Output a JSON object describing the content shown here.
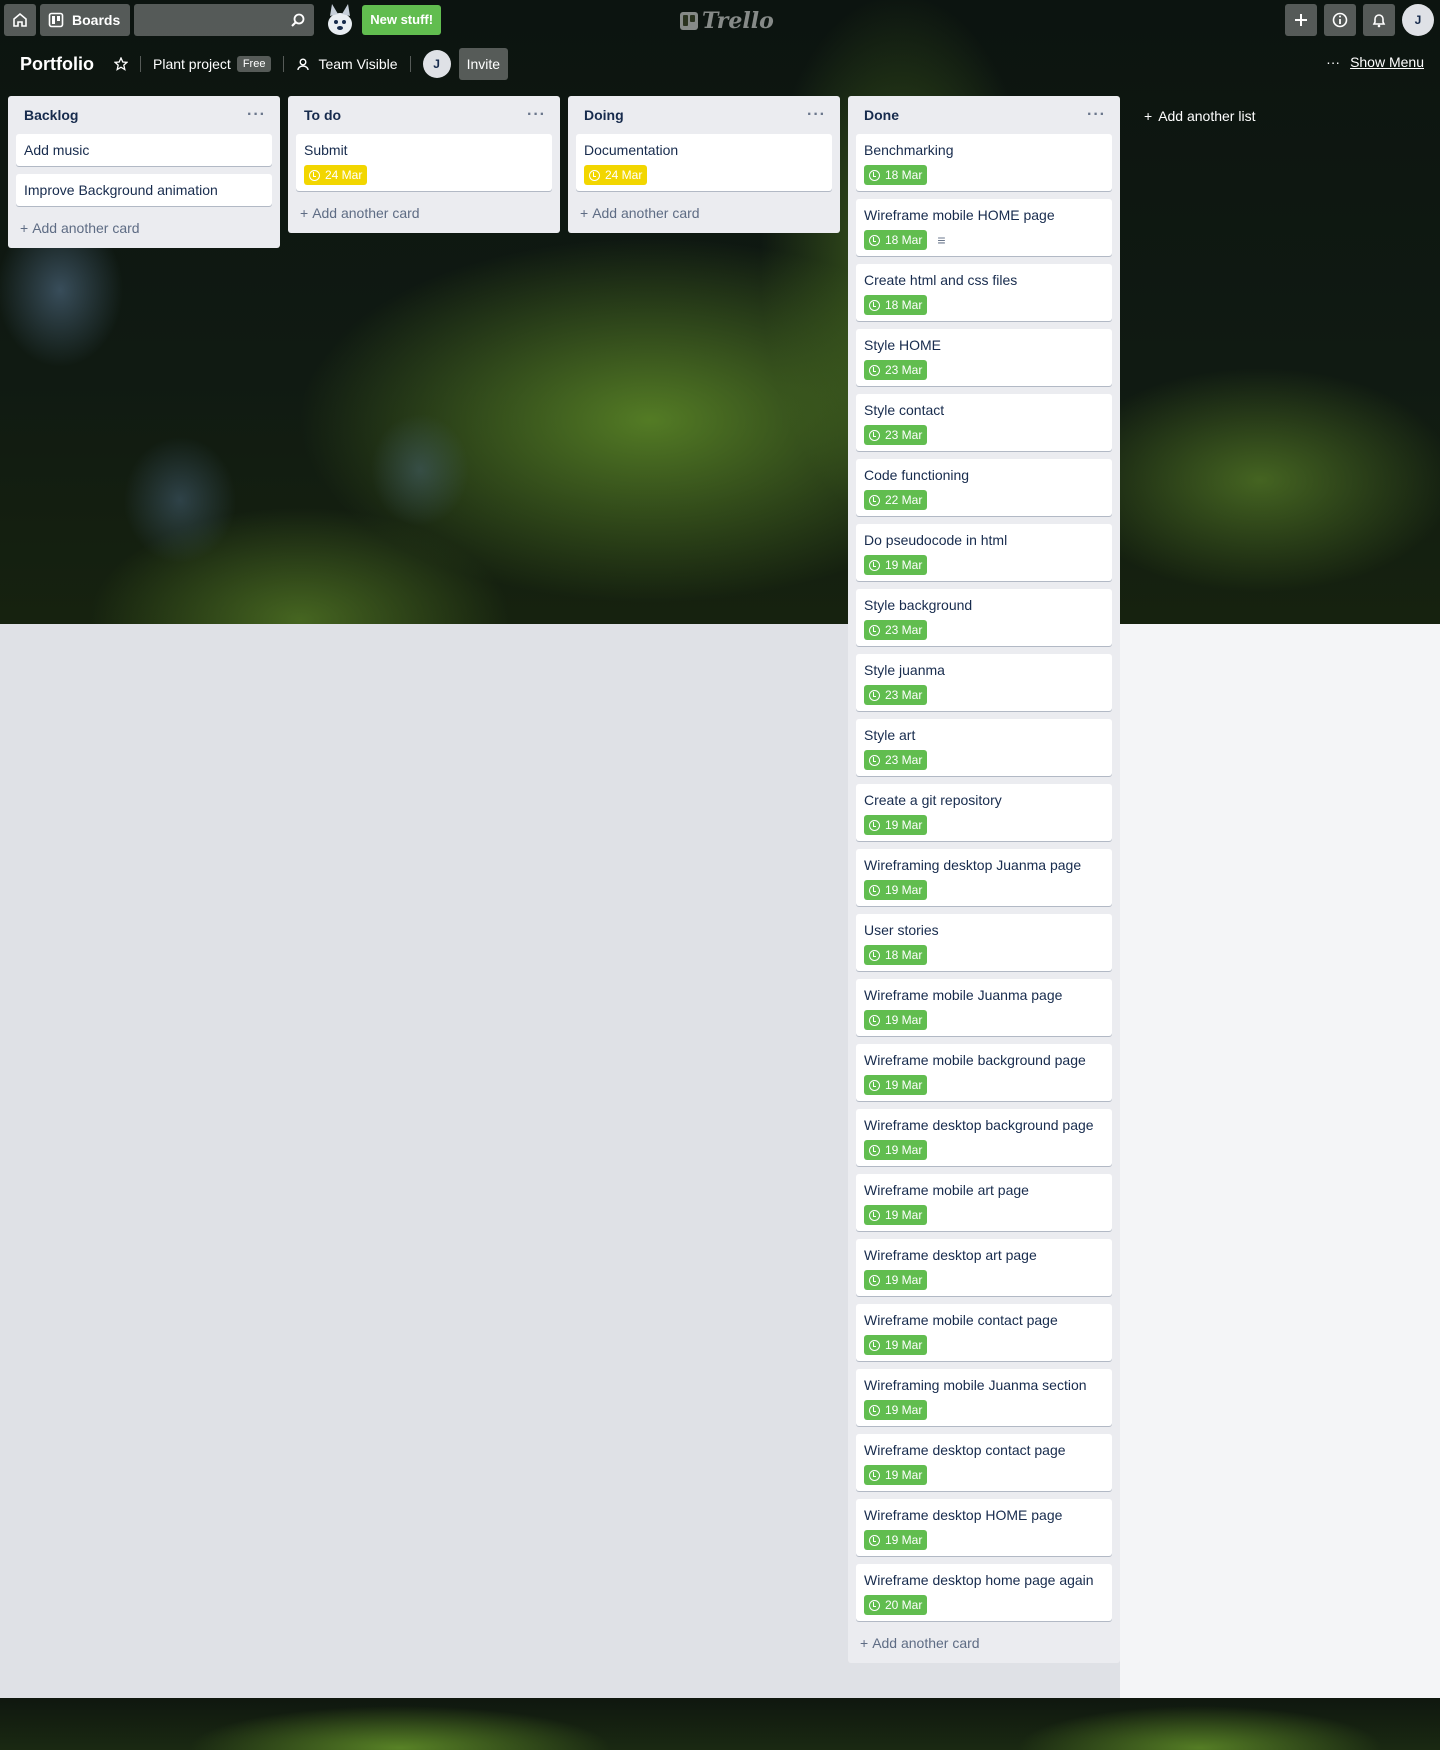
{
  "topnav": {
    "boards_label": "Boards",
    "new_stuff_label": "New stuff!",
    "logo_text": "Trello",
    "user_initial": "J"
  },
  "board": {
    "title": "Portfolio",
    "team_name": "Plant project",
    "team_badge": "Free",
    "visibility": "Team Visible",
    "member_initial": "J",
    "invite_label": "Invite",
    "show_menu_label": "Show Menu",
    "add_list_label": "Add another list"
  },
  "lists": [
    {
      "name": "Backlog",
      "add_card_label": "Add another card",
      "cards": [
        {
          "title": "Add music"
        },
        {
          "title": "Improve Background animation"
        }
      ]
    },
    {
      "name": "To do",
      "add_card_label": "Add another card",
      "cards": [
        {
          "title": "Submit",
          "due": "24 Mar",
          "due_color": "#f2d600"
        }
      ]
    },
    {
      "name": "Doing",
      "add_card_label": "Add another card",
      "cards": [
        {
          "title": "Documentation",
          "due": "24 Mar",
          "due_color": "#f2d600"
        }
      ]
    },
    {
      "name": "Done",
      "add_card_label": "Add another card",
      "cards": [
        {
          "title": "Benchmarking",
          "due": "18 Mar",
          "due_color": "#61bd4f"
        },
        {
          "title": "Wireframe mobile HOME page",
          "due": "18 Mar",
          "due_color": "#61bd4f",
          "has_description": true
        },
        {
          "title": "Create html and css files",
          "due": "18 Mar",
          "due_color": "#61bd4f"
        },
        {
          "title": "Style HOME",
          "due": "23 Mar",
          "due_color": "#61bd4f"
        },
        {
          "title": "Style contact",
          "due": "23 Mar",
          "due_color": "#61bd4f"
        },
        {
          "title": "Code functioning",
          "due": "22 Mar",
          "due_color": "#61bd4f"
        },
        {
          "title": "Do pseudocode in html",
          "due": "19 Mar",
          "due_color": "#61bd4f"
        },
        {
          "title": "Style background",
          "due": "23 Mar",
          "due_color": "#61bd4f"
        },
        {
          "title": "Style juanma",
          "due": "23 Mar",
          "due_color": "#61bd4f"
        },
        {
          "title": "Style art",
          "due": "23 Mar",
          "due_color": "#61bd4f"
        },
        {
          "title": "Create a git repository",
          "due": "19 Mar",
          "due_color": "#61bd4f"
        },
        {
          "title": "Wireframing desktop Juanma page",
          "due": "19 Mar",
          "due_color": "#61bd4f"
        },
        {
          "title": "User stories",
          "due": "18 Mar",
          "due_color": "#61bd4f"
        },
        {
          "title": "Wireframe mobile Juanma page",
          "due": "19 Mar",
          "due_color": "#61bd4f"
        },
        {
          "title": "Wireframe mobile background page",
          "due": "19 Mar",
          "due_color": "#61bd4f"
        },
        {
          "title": "Wireframe desktop background page",
          "due": "19 Mar",
          "due_color": "#61bd4f"
        },
        {
          "title": "Wireframe mobile art page",
          "due": "19 Mar",
          "due_color": "#61bd4f"
        },
        {
          "title": "Wireframe desktop art page",
          "due": "19 Mar",
          "due_color": "#61bd4f"
        },
        {
          "title": "Wireframe mobile contact page",
          "due": "19 Mar",
          "due_color": "#61bd4f"
        },
        {
          "title": "Wireframing mobile Juanma section",
          "due": "19 Mar",
          "due_color": "#61bd4f"
        },
        {
          "title": "Wireframe desktop contact page",
          "due": "19 Mar",
          "due_color": "#61bd4f"
        },
        {
          "title": "Wireframe desktop HOME page",
          "due": "19 Mar",
          "due_color": "#61bd4f"
        },
        {
          "title": "Wireframe desktop home page again",
          "due": "20 Mar",
          "due_color": "#61bd4f"
        }
      ]
    }
  ],
  "colors": {
    "due_done": "#61bd4f",
    "due_soon": "#f2d600",
    "list_bg": "#ebecf0"
  }
}
